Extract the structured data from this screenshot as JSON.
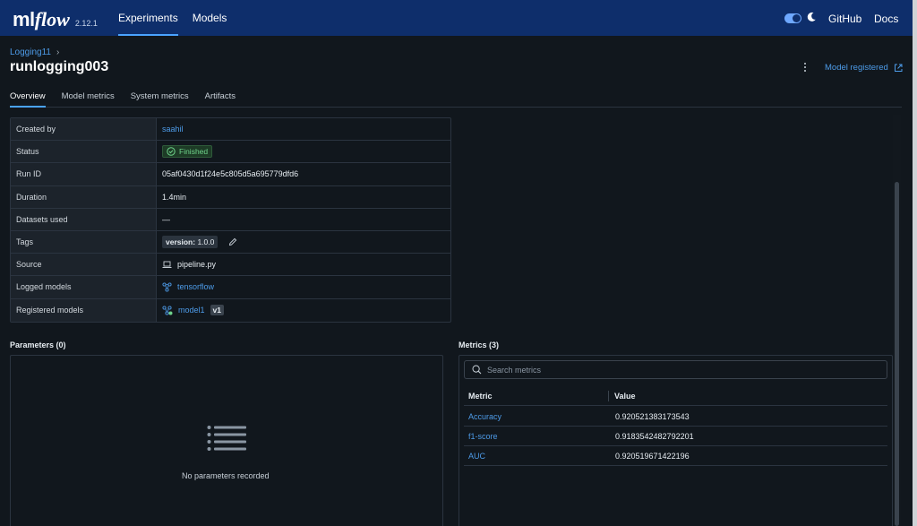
{
  "header": {
    "logo_ml": "ml",
    "logo_flow": "flow",
    "version": "2.12.1",
    "nav": [
      {
        "label": "Experiments",
        "active": true
      },
      {
        "label": "Models",
        "active": false
      }
    ],
    "github_label": "GitHub",
    "docs_label": "Docs"
  },
  "run": {
    "breadcrumb": "Logging11",
    "breadcrumb_sep": "›",
    "title": "runlogging003",
    "model_registered_label": "Model registered"
  },
  "tabs": [
    {
      "label": "Overview",
      "active": true
    },
    {
      "label": "Model metrics",
      "active": false
    },
    {
      "label": "System metrics",
      "active": false
    },
    {
      "label": "Artifacts",
      "active": false
    }
  ],
  "details": {
    "created_by_label": "Created by",
    "created_by": "saahil",
    "status_label": "Status",
    "status": "Finished",
    "run_id_label": "Run ID",
    "run_id": "05af0430d1f24e5c805d5a695779dfd6",
    "duration_label": "Duration",
    "duration": "1.4min",
    "datasets_label": "Datasets used",
    "datasets": "—",
    "tags_label": "Tags",
    "tag_key": "version:",
    "tag_value": "1.0.0",
    "source_label": "Source",
    "source": "pipeline.py",
    "logged_models_label": "Logged models",
    "logged_model": "tensorflow",
    "registered_models_label": "Registered models",
    "registered_model": "model1",
    "registered_version": "v1"
  },
  "parameters": {
    "title": "Parameters (0)",
    "empty_text": "No parameters recorded"
  },
  "metrics": {
    "title": "Metrics (3)",
    "search_placeholder": "Search metrics",
    "col_metric": "Metric",
    "col_value": "Value",
    "rows": [
      {
        "name": "Accuracy",
        "value": "0.920521383173543"
      },
      {
        "name": "f1-score",
        "value": "0.9183542482792201"
      },
      {
        "name": "AUC",
        "value": "0.920519671422196"
      }
    ]
  },
  "colors": {
    "header_bg": "#0e2e6b",
    "page_bg": "#11171d",
    "link": "#4d9be8",
    "accent": "#4aa3ff",
    "success": "#6fd38b"
  }
}
